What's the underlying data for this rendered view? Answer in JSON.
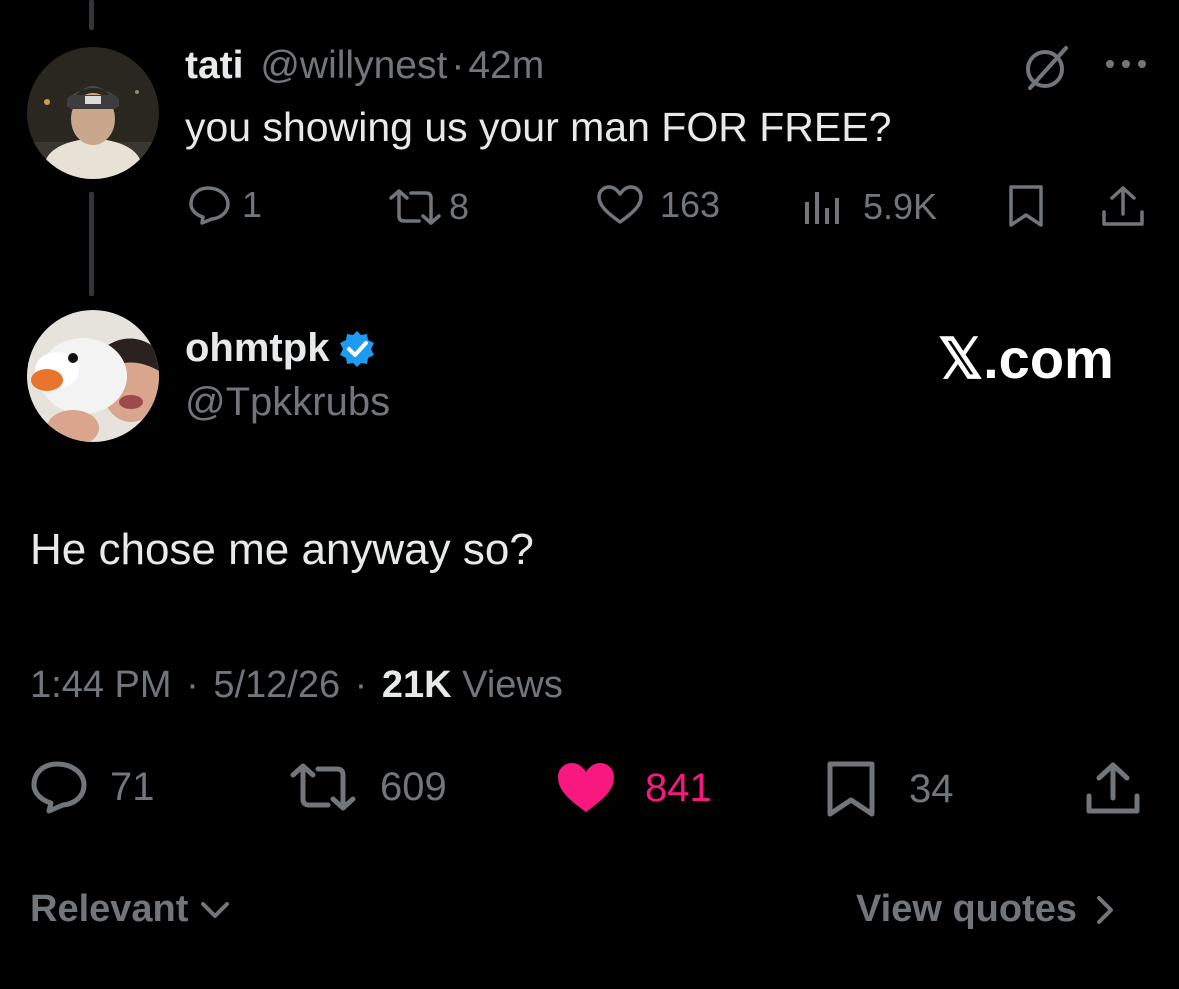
{
  "reply_parent": {
    "display_name": "tati",
    "handle": "@willynest",
    "separator": "·",
    "time_ago": "42m",
    "text": "you showing us your man FOR FREE?",
    "more_label": "···",
    "stats": {
      "replies": "1",
      "reposts": "8",
      "likes": "163",
      "views": "5.9K"
    }
  },
  "main_tweet": {
    "display_name": "ohmtpk",
    "handle": "@Tpkkrubs",
    "verified": true,
    "watermark": "𝕏.com",
    "text": "He chose me anyway so?",
    "time": "1:44 PM",
    "sep1": "·",
    "date": "5/12/26",
    "sep2": "·",
    "views_count": "21K",
    "views_label": "Views",
    "stats": {
      "replies": "71",
      "reposts": "609",
      "likes": "841",
      "bookmarks": "34"
    }
  },
  "footer": {
    "sort_label": "Relevant",
    "quotes_label": "View quotes"
  },
  "colors": {
    "background": "#000000",
    "text": "#e7e9ea",
    "muted": "#71767b",
    "like_active": "#f91880",
    "verified_badge": "#1d9bf0"
  }
}
